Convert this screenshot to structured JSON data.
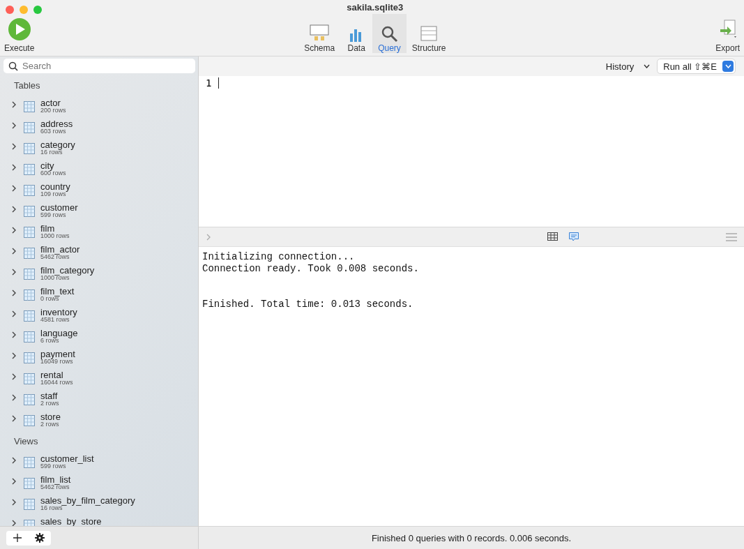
{
  "window": {
    "title": "sakila.sqlite3"
  },
  "toolbar": {
    "execute": "Execute",
    "export": "Export",
    "tabs": [
      {
        "label": "Schema",
        "kind": "schema",
        "selected": false
      },
      {
        "label": "Data",
        "kind": "data",
        "selected": false
      },
      {
        "label": "Query",
        "kind": "query",
        "selected": true
      },
      {
        "label": "Structure",
        "kind": "structure",
        "selected": false
      }
    ]
  },
  "sidebar": {
    "search": {
      "placeholder": "Search"
    },
    "sections": [
      {
        "title": "Tables",
        "items": [
          {
            "name": "actor",
            "rows": "200 rows"
          },
          {
            "name": "address",
            "rows": "603 rows"
          },
          {
            "name": "category",
            "rows": "16 rows"
          },
          {
            "name": "city",
            "rows": "600 rows"
          },
          {
            "name": "country",
            "rows": "109 rows"
          },
          {
            "name": "customer",
            "rows": "599 rows"
          },
          {
            "name": "film",
            "rows": "1000 rows"
          },
          {
            "name": "film_actor",
            "rows": "5462 rows"
          },
          {
            "name": "film_category",
            "rows": "1000 rows"
          },
          {
            "name": "film_text",
            "rows": "0 rows"
          },
          {
            "name": "inventory",
            "rows": "4581 rows"
          },
          {
            "name": "language",
            "rows": "6 rows"
          },
          {
            "name": "payment",
            "rows": "16049 rows"
          },
          {
            "name": "rental",
            "rows": "16044 rows"
          },
          {
            "name": "staff",
            "rows": "2 rows"
          },
          {
            "name": "store",
            "rows": "2 rows"
          }
        ]
      },
      {
        "title": "Views",
        "items": [
          {
            "name": "customer_list",
            "rows": "599 rows"
          },
          {
            "name": "film_list",
            "rows": "5462 rows"
          },
          {
            "name": "sales_by_film_category",
            "rows": "16 rows"
          },
          {
            "name": "sales_by_store"
          }
        ]
      }
    ]
  },
  "query_bar": {
    "history": "History",
    "run": "Run all ⇧⌘E"
  },
  "editor": {
    "lines": [
      "1"
    ]
  },
  "results": {
    "views": [
      {
        "kind": "grid",
        "selected": false
      },
      {
        "kind": "text",
        "selected": true
      }
    ],
    "output": "Initializing connection...\nConnection ready. Took 0.008 seconds.\n\n\nFinished. Total time: 0.013 seconds."
  },
  "status_bar": "Finished 0 queries with 0 records. 0.006 seconds."
}
